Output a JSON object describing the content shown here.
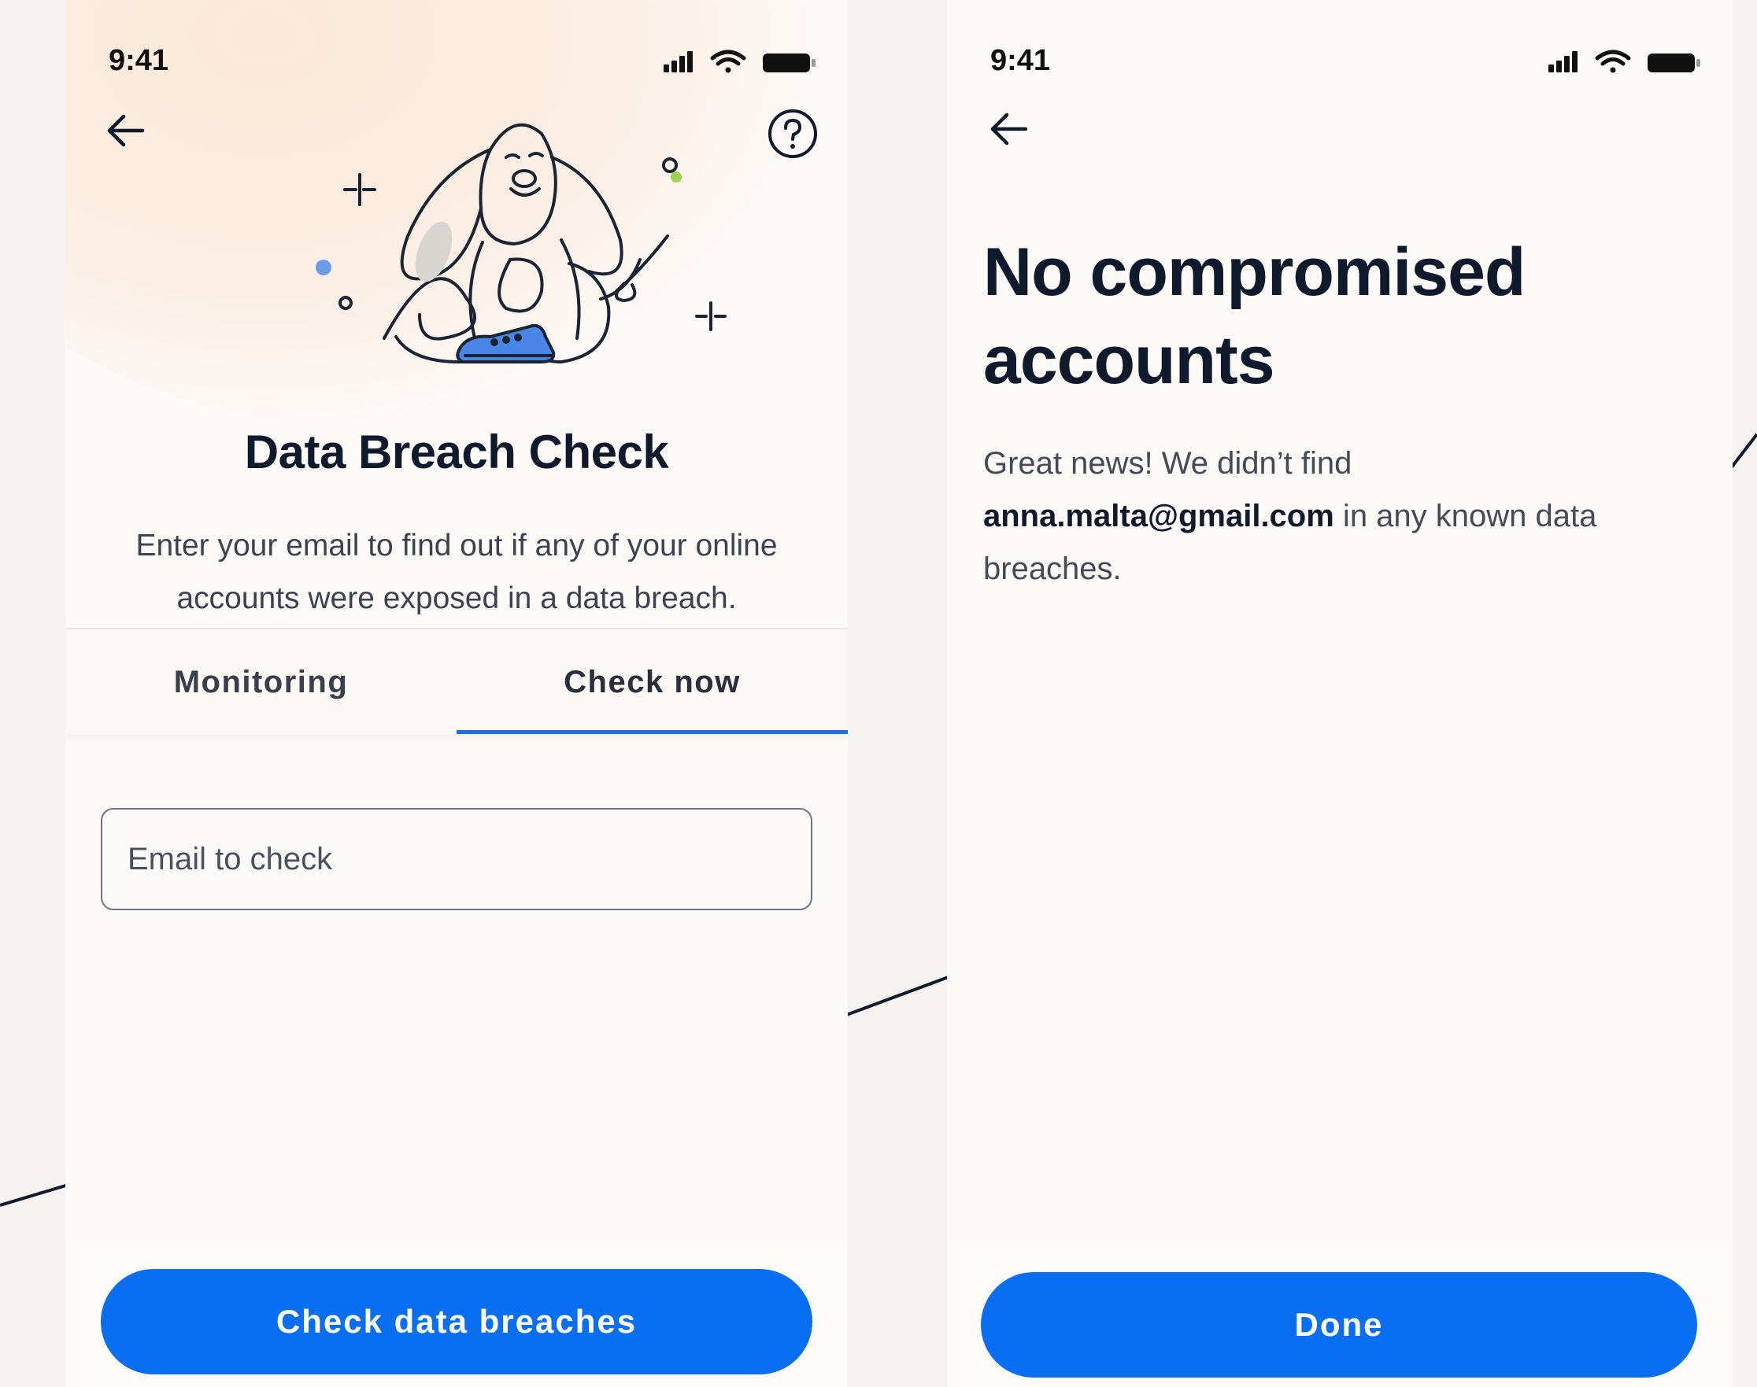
{
  "status_bar": {
    "time": "9:41"
  },
  "screen_check": {
    "title": "Data Breach Check",
    "subtitle": "Enter your email to find out if any of your online accounts were exposed in a data breach.",
    "tabs": [
      {
        "label": "Monitoring",
        "active": false
      },
      {
        "label": "Check now",
        "active": true
      }
    ],
    "email_field": {
      "placeholder": "Email to check",
      "value": ""
    },
    "submit_button": "Check data breaches"
  },
  "screen_result": {
    "title": "No compromised accounts",
    "message_before": "Great news! We didn’t find",
    "email": "anna.malta@gmail.com",
    "message_after": " in any known data breaches.",
    "done_button": "Done"
  },
  "colors": {
    "accent": "#0a6ef0",
    "tab_indicator": "#1f6fe0",
    "text_dark": "#0f1b2d",
    "background": "#f6f3f1",
    "screen_bg": "#fdfaf8"
  },
  "icons": [
    "back-arrow-icon",
    "help-icon",
    "signal-icon",
    "wifi-icon",
    "battery-icon",
    "dog-illustration"
  ]
}
